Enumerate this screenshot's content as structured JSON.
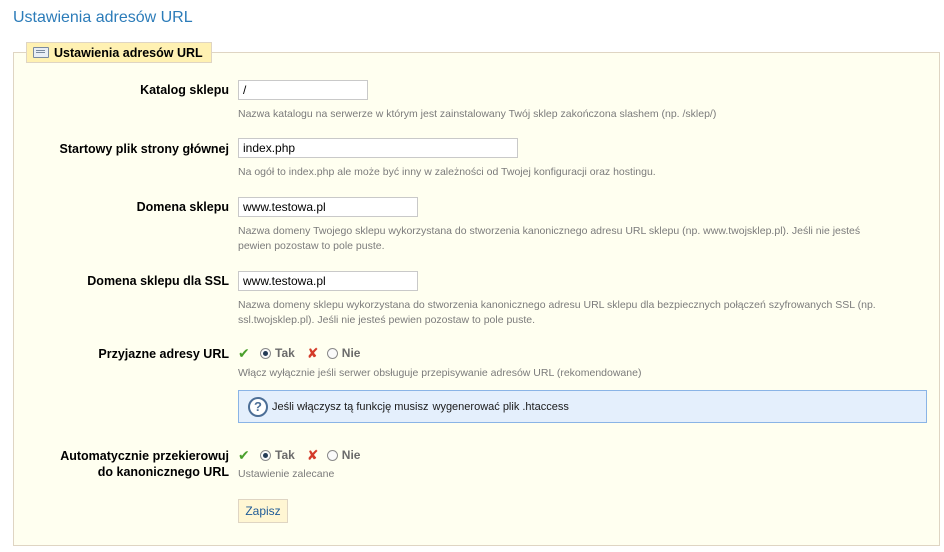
{
  "page": {
    "title": "Ustawienia adresów URL"
  },
  "fieldset": {
    "legend": "Ustawienia adresów URL",
    "legend_icon": "keyboard-icon"
  },
  "fields": {
    "shop_dir": {
      "label": "Katalog sklepu",
      "value": "/",
      "hint": "Nazwa katalogu na serwerze w którym jest zainstalowany Twój sklep zakończona slashem (np. /sklep/)"
    },
    "index_file": {
      "label": "Startowy plik strony głównej",
      "value": "index.php",
      "hint": "Na ogół to index.php ale może być inny w zależności od Twojej konfiguracji oraz hostingu."
    },
    "domain": {
      "label": "Domena sklepu",
      "value": "www.testowa.pl",
      "hint_line1": "Nazwa domeny Twojego sklepu wykorzystana do stworzenia kanonicznego adresu URL sklepu (np. www.twojsklep.pl). Jeśli nie jesteś",
      "hint_line2": "pewien pozostaw to pole puste."
    },
    "domain_ssl": {
      "label": "Domena sklepu dla SSL",
      "value": "www.testowa.pl",
      "hint_line1": "Nazwa domeny sklepu wykorzystana do stworzenia kanonicznego adresu URL sklepu dla bezpiecznych połączeń szyfrowanych SSL (np.",
      "hint_line2": "ssl.twojsklep.pl). Jeśli nie jesteś pewien pozostaw to pole puste."
    },
    "friendly_urls": {
      "label": "Przyjazne adresy URL",
      "yes": "Tak",
      "no": "Nie",
      "selected": "yes",
      "hint": "Włącz wyłącznie jeśli serwer obsługuje przepisywanie adresów URL (rekomendowane)",
      "info_text": "Jeśli włączysz tą funkcję musisz",
      "info_link": "wygenerować plik .htaccess"
    },
    "canonical_redirect": {
      "label_line1": "Automatycznie przekierowuj",
      "label_line2": "do kanonicznego URL",
      "yes": "Tak",
      "no": "Nie",
      "selected": "yes",
      "hint": "Ustawienie zalecane"
    }
  },
  "buttons": {
    "save": "Zapisz"
  },
  "colors": {
    "title": "#2c7cb9",
    "fieldset_bg": "#fffff0",
    "legend_bg": "#fff1b2",
    "info_bg": "#e4effc",
    "check": "#4aa02c",
    "cross": "#d43b2a"
  }
}
